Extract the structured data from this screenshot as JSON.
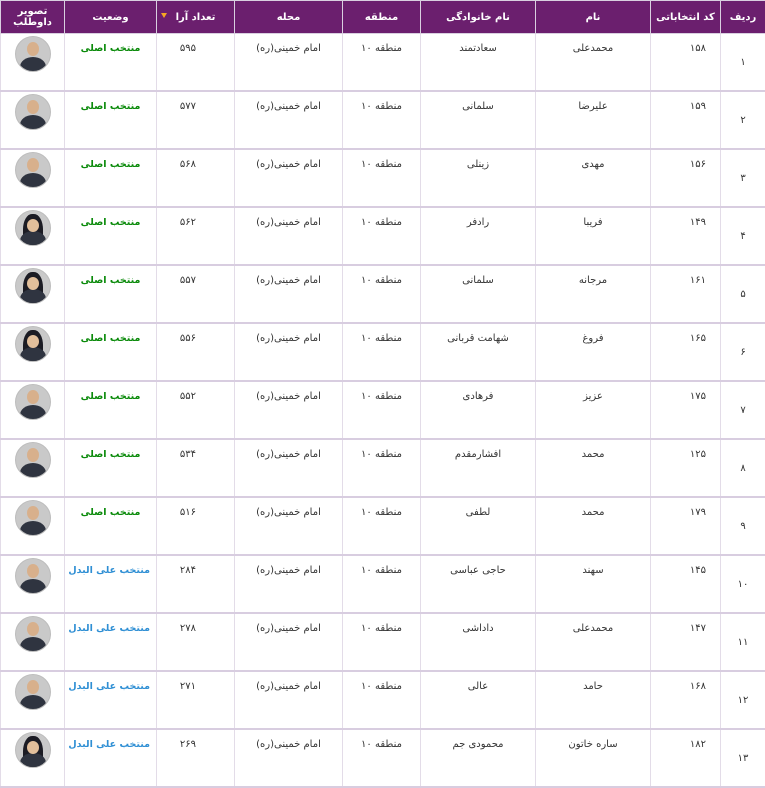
{
  "headers": {
    "row": "ردیف",
    "code": "کد انتخاباتی",
    "name": "نام",
    "family": "نام خانوادگی",
    "region": "منطقه",
    "hood": "محله",
    "votes": "تعداد آرا",
    "status": "وضعیت",
    "photo": "تصویر داوطلب"
  },
  "sort_indicator_icon": "sort-desc-arrow",
  "colors": {
    "header_bg": "#6b1f6e",
    "status_main": "#0a8a0a",
    "status_alt": "#2f8fd4",
    "sort_arrow": "#f5a623"
  },
  "rows": [
    {
      "row": "۱",
      "code": "۱۵۸",
      "name": "محمدعلی",
      "family": "سعادتمند",
      "region": "منطقه ۱۰",
      "hood": "امام خمینی(ره)",
      "votes": "۵۹۵",
      "status": "منتخب اصلی",
      "status_type": "main",
      "photo": "avatar-male"
    },
    {
      "row": "۲",
      "code": "۱۵۹",
      "name": "علیرضا",
      "family": "سلمانی",
      "region": "منطقه ۱۰",
      "hood": "امام خمینی(ره)",
      "votes": "۵۷۷",
      "status": "منتخب اصلی",
      "status_type": "main",
      "photo": "avatar-male"
    },
    {
      "row": "۳",
      "code": "۱۵۶",
      "name": "مهدی",
      "family": "زینلی",
      "region": "منطقه ۱۰",
      "hood": "امام خمینی(ره)",
      "votes": "۵۶۸",
      "status": "منتخب اصلی",
      "status_type": "main",
      "photo": "avatar-male"
    },
    {
      "row": "۴",
      "code": "۱۴۹",
      "name": "فریبا",
      "family": "رادفر",
      "region": "منطقه ۱۰",
      "hood": "امام خمینی(ره)",
      "votes": "۵۶۲",
      "status": "منتخب اصلی",
      "status_type": "main",
      "photo": "avatar-female"
    },
    {
      "row": "۵",
      "code": "۱۶۱",
      "name": "مرجانه",
      "family": "سلمانی",
      "region": "منطقه ۱۰",
      "hood": "امام خمینی(ره)",
      "votes": "۵۵۷",
      "status": "منتخب اصلی",
      "status_type": "main",
      "photo": "avatar-female"
    },
    {
      "row": "۶",
      "code": "۱۶۵",
      "name": "فروغ",
      "family": "شهامت قربانی",
      "region": "منطقه ۱۰",
      "hood": "امام خمینی(ره)",
      "votes": "۵۵۶",
      "status": "منتخب اصلی",
      "status_type": "main",
      "photo": "avatar-female"
    },
    {
      "row": "۷",
      "code": "۱۷۵",
      "name": "عزیز",
      "family": "فرهادی",
      "region": "منطقه ۱۰",
      "hood": "امام خمینی(ره)",
      "votes": "۵۵۲",
      "status": "منتخب اصلی",
      "status_type": "main",
      "photo": "avatar-male"
    },
    {
      "row": "۸",
      "code": "۱۲۵",
      "name": "محمد",
      "family": "افشارمقدم",
      "region": "منطقه ۱۰",
      "hood": "امام خمینی(ره)",
      "votes": "۵۳۴",
      "status": "منتخب اصلی",
      "status_type": "main",
      "photo": "avatar-male"
    },
    {
      "row": "۹",
      "code": "۱۷۹",
      "name": "محمد",
      "family": "لطفی",
      "region": "منطقه ۱۰",
      "hood": "امام خمینی(ره)",
      "votes": "۵۱۶",
      "status": "منتخب اصلی",
      "status_type": "main",
      "photo": "avatar-male"
    },
    {
      "row": "۱۰",
      "code": "۱۴۵",
      "name": "سهند",
      "family": "حاجی عباسی",
      "region": "منطقه ۱۰",
      "hood": "امام خمینی(ره)",
      "votes": "۲۸۴",
      "status": "منتخب علی البدل",
      "status_type": "alt",
      "photo": "avatar-male"
    },
    {
      "row": "۱۱",
      "code": "۱۴۷",
      "name": "محمدعلی",
      "family": "داداشی",
      "region": "منطقه ۱۰",
      "hood": "امام خمینی(ره)",
      "votes": "۲۷۸",
      "status": "منتخب علی البدل",
      "status_type": "alt",
      "photo": "avatar-male"
    },
    {
      "row": "۱۲",
      "code": "۱۶۸",
      "name": "حامد",
      "family": "عالی",
      "region": "منطقه ۱۰",
      "hood": "امام خمینی(ره)",
      "votes": "۲۷۱",
      "status": "منتخب علی البدل",
      "status_type": "alt",
      "photo": "avatar-male"
    },
    {
      "row": "۱۳",
      "code": "۱۸۲",
      "name": "ساره خاتون",
      "family": "محمودی جم",
      "region": "منطقه ۱۰",
      "hood": "امام خمینی(ره)",
      "votes": "۲۶۹",
      "status": "منتخب علی البدل",
      "status_type": "alt",
      "photo": "avatar-female"
    }
  ]
}
